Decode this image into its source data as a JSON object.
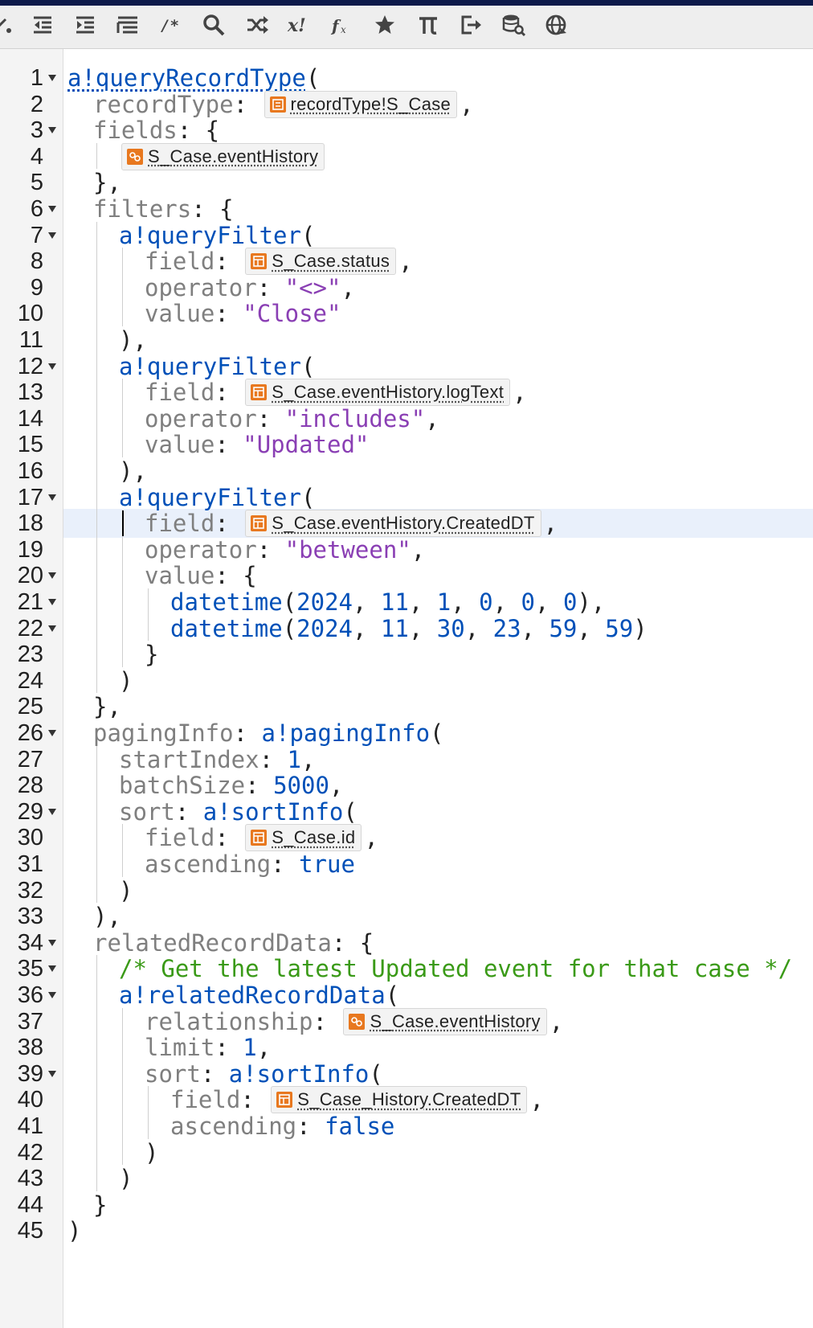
{
  "toolbar": {
    "buttons": [
      {
        "name": "partial-icon",
        "interactable": true
      },
      {
        "name": "outdent-icon",
        "interactable": true
      },
      {
        "name": "indent-icon",
        "interactable": true
      },
      {
        "name": "format-icon",
        "interactable": true
      },
      {
        "name": "comment-icon",
        "interactable": true
      },
      {
        "name": "search-icon",
        "interactable": true
      },
      {
        "name": "shuffle-icon",
        "interactable": true
      },
      {
        "name": "test-variable-icon",
        "interactable": true
      },
      {
        "name": "function-icon",
        "interactable": true
      },
      {
        "name": "favorite-star-icon",
        "interactable": true
      },
      {
        "name": "pi-constant-icon",
        "interactable": true
      },
      {
        "name": "export-icon",
        "interactable": true
      },
      {
        "name": "query-data-icon",
        "interactable": true
      },
      {
        "name": "web-api-icon",
        "interactable": true
      }
    ]
  },
  "editor": {
    "highlighted_line": 18,
    "fold_lines": [
      1,
      3,
      6,
      7,
      12,
      17,
      20,
      21,
      22,
      26,
      29,
      34,
      35,
      36,
      39
    ],
    "lines": [
      {
        "n": "1",
        "indent": 0,
        "tokens": [
          {
            "c": "kwu",
            "t": "a!queryRecordType"
          },
          {
            "c": "pun",
            "t": "("
          }
        ]
      },
      {
        "n": "2",
        "indent": 1,
        "tokens": [
          {
            "c": "key",
            "t": "recordType"
          },
          {
            "c": "pun",
            "t": ": "
          },
          {
            "c": "chip",
            "icon": "record",
            "t": "recordType!S_Case"
          },
          {
            "c": "pun",
            "t": ","
          }
        ]
      },
      {
        "n": "3",
        "indent": 1,
        "tokens": [
          {
            "c": "key",
            "t": "fields"
          },
          {
            "c": "pun",
            "t": ": {"
          }
        ]
      },
      {
        "n": "4",
        "indent": 2,
        "tokens": [
          {
            "c": "chip",
            "icon": "relation",
            "t": "S_Case.eventHistory"
          }
        ]
      },
      {
        "n": "5",
        "indent": 1,
        "tokens": [
          {
            "c": "pun",
            "t": "},"
          }
        ]
      },
      {
        "n": "6",
        "indent": 1,
        "tokens": [
          {
            "c": "key",
            "t": "filters"
          },
          {
            "c": "pun",
            "t": ": {"
          }
        ]
      },
      {
        "n": "7",
        "indent": 2,
        "tokens": [
          {
            "c": "kw",
            "t": "a!queryFilter"
          },
          {
            "c": "pun",
            "t": "("
          }
        ]
      },
      {
        "n": "8",
        "indent": 3,
        "tokens": [
          {
            "c": "key",
            "t": "field"
          },
          {
            "c": "pun",
            "t": ": "
          },
          {
            "c": "chip",
            "icon": "field",
            "t": "S_Case.status"
          },
          {
            "c": "pun",
            "t": ","
          }
        ]
      },
      {
        "n": "9",
        "indent": 3,
        "tokens": [
          {
            "c": "key",
            "t": "operator"
          },
          {
            "c": "pun",
            "t": ": "
          },
          {
            "c": "str",
            "t": "\"<>\""
          },
          {
            "c": "pun",
            "t": ","
          }
        ]
      },
      {
        "n": "10",
        "indent": 3,
        "tokens": [
          {
            "c": "key",
            "t": "value"
          },
          {
            "c": "pun",
            "t": ": "
          },
          {
            "c": "str",
            "t": "\"Close\""
          }
        ]
      },
      {
        "n": "11",
        "indent": 2,
        "tokens": [
          {
            "c": "pun",
            "t": "),"
          }
        ]
      },
      {
        "n": "12",
        "indent": 2,
        "tokens": [
          {
            "c": "kw",
            "t": "a!queryFilter"
          },
          {
            "c": "pun",
            "t": "("
          }
        ]
      },
      {
        "n": "13",
        "indent": 3,
        "tokens": [
          {
            "c": "key",
            "t": "field"
          },
          {
            "c": "pun",
            "t": ": "
          },
          {
            "c": "chip",
            "icon": "field",
            "t": "S_Case.eventHistory.logText"
          },
          {
            "c": "pun",
            "t": ","
          }
        ]
      },
      {
        "n": "14",
        "indent": 3,
        "tokens": [
          {
            "c": "key",
            "t": "operator"
          },
          {
            "c": "pun",
            "t": ": "
          },
          {
            "c": "str",
            "t": "\"includes\""
          },
          {
            "c": "pun",
            "t": ","
          }
        ]
      },
      {
        "n": "15",
        "indent": 3,
        "tokens": [
          {
            "c": "key",
            "t": "value"
          },
          {
            "c": "pun",
            "t": ": "
          },
          {
            "c": "str",
            "t": "\"Updated\""
          }
        ]
      },
      {
        "n": "16",
        "indent": 2,
        "tokens": [
          {
            "c": "pun",
            "t": "),"
          }
        ]
      },
      {
        "n": "17",
        "indent": 2,
        "tokens": [
          {
            "c": "kw",
            "t": "a!queryFilter"
          },
          {
            "c": "pun",
            "t": "("
          }
        ]
      },
      {
        "n": "18",
        "indent": 3,
        "tokens": [
          {
            "c": "key",
            "t": "field"
          },
          {
            "c": "pun",
            "t": ": "
          },
          {
            "c": "chip",
            "icon": "field",
            "t": "S_Case.eventHistory.CreatedDT"
          },
          {
            "c": "pun",
            "t": ","
          }
        ]
      },
      {
        "n": "19",
        "indent": 3,
        "tokens": [
          {
            "c": "key",
            "t": "operator"
          },
          {
            "c": "pun",
            "t": ": "
          },
          {
            "c": "str",
            "t": "\"between\""
          },
          {
            "c": "pun",
            "t": ","
          }
        ]
      },
      {
        "n": "20",
        "indent": 3,
        "tokens": [
          {
            "c": "key",
            "t": "value"
          },
          {
            "c": "pun",
            "t": ": {"
          }
        ]
      },
      {
        "n": "21",
        "indent": 4,
        "tokens": [
          {
            "c": "kw",
            "t": "datetime"
          },
          {
            "c": "pun",
            "t": "("
          },
          {
            "c": "num",
            "t": "2024"
          },
          {
            "c": "pun",
            "t": ", "
          },
          {
            "c": "num",
            "t": "11"
          },
          {
            "c": "pun",
            "t": ", "
          },
          {
            "c": "num",
            "t": "1"
          },
          {
            "c": "pun",
            "t": ", "
          },
          {
            "c": "num",
            "t": "0"
          },
          {
            "c": "pun",
            "t": ", "
          },
          {
            "c": "num",
            "t": "0"
          },
          {
            "c": "pun",
            "t": ", "
          },
          {
            "c": "num",
            "t": "0"
          },
          {
            "c": "pun",
            "t": "),"
          }
        ]
      },
      {
        "n": "22",
        "indent": 4,
        "tokens": [
          {
            "c": "kw",
            "t": "datetime"
          },
          {
            "c": "pun",
            "t": "("
          },
          {
            "c": "num",
            "t": "2024"
          },
          {
            "c": "pun",
            "t": ", "
          },
          {
            "c": "num",
            "t": "11"
          },
          {
            "c": "pun",
            "t": ", "
          },
          {
            "c": "num",
            "t": "30"
          },
          {
            "c": "pun",
            "t": ", "
          },
          {
            "c": "num",
            "t": "23"
          },
          {
            "c": "pun",
            "t": ", "
          },
          {
            "c": "num",
            "t": "59"
          },
          {
            "c": "pun",
            "t": ", "
          },
          {
            "c": "num",
            "t": "59"
          },
          {
            "c": "pun",
            "t": ")"
          }
        ]
      },
      {
        "n": "23",
        "indent": 3,
        "tokens": [
          {
            "c": "pun",
            "t": "}"
          }
        ]
      },
      {
        "n": "24",
        "indent": 2,
        "tokens": [
          {
            "c": "pun",
            "t": ")"
          }
        ]
      },
      {
        "n": "25",
        "indent": 1,
        "tokens": [
          {
            "c": "pun",
            "t": "},"
          }
        ]
      },
      {
        "n": "26",
        "indent": 1,
        "tokens": [
          {
            "c": "key",
            "t": "pagingInfo"
          },
          {
            "c": "pun",
            "t": ": "
          },
          {
            "c": "kw",
            "t": "a!pagingInfo"
          },
          {
            "c": "pun",
            "t": "("
          }
        ]
      },
      {
        "n": "27",
        "indent": 2,
        "tokens": [
          {
            "c": "key",
            "t": "startIndex"
          },
          {
            "c": "pun",
            "t": ": "
          },
          {
            "c": "num",
            "t": "1"
          },
          {
            "c": "pun",
            "t": ","
          }
        ]
      },
      {
        "n": "28",
        "indent": 2,
        "tokens": [
          {
            "c": "key",
            "t": "batchSize"
          },
          {
            "c": "pun",
            "t": ": "
          },
          {
            "c": "num",
            "t": "5000"
          },
          {
            "c": "pun",
            "t": ","
          }
        ]
      },
      {
        "n": "29",
        "indent": 2,
        "tokens": [
          {
            "c": "key",
            "t": "sort"
          },
          {
            "c": "pun",
            "t": ": "
          },
          {
            "c": "kw",
            "t": "a!sortInfo"
          },
          {
            "c": "pun",
            "t": "("
          }
        ]
      },
      {
        "n": "30",
        "indent": 3,
        "tokens": [
          {
            "c": "key",
            "t": "field"
          },
          {
            "c": "pun",
            "t": ": "
          },
          {
            "c": "chip",
            "icon": "field",
            "t": "S_Case.id"
          },
          {
            "c": "pun",
            "t": ","
          }
        ]
      },
      {
        "n": "31",
        "indent": 3,
        "tokens": [
          {
            "c": "key",
            "t": "ascending"
          },
          {
            "c": "pun",
            "t": ": "
          },
          {
            "c": "bool",
            "t": "true"
          }
        ]
      },
      {
        "n": "32",
        "indent": 2,
        "tokens": [
          {
            "c": "pun",
            "t": ")"
          }
        ]
      },
      {
        "n": "33",
        "indent": 1,
        "tokens": [
          {
            "c": "pun",
            "t": "),"
          }
        ]
      },
      {
        "n": "34",
        "indent": 1,
        "tokens": [
          {
            "c": "key",
            "t": "relatedRecordData"
          },
          {
            "c": "pun",
            "t": ": {"
          }
        ]
      },
      {
        "n": "35",
        "indent": 2,
        "tokens": [
          {
            "c": "com",
            "t": "/* Get the latest Updated event for that case */"
          }
        ]
      },
      {
        "n": "36",
        "indent": 2,
        "tokens": [
          {
            "c": "kw",
            "t": "a!relatedRecordData"
          },
          {
            "c": "pun",
            "t": "("
          }
        ]
      },
      {
        "n": "37",
        "indent": 3,
        "tokens": [
          {
            "c": "key",
            "t": "relationship"
          },
          {
            "c": "pun",
            "t": ": "
          },
          {
            "c": "chip",
            "icon": "relation",
            "t": "S_Case.eventHistory"
          },
          {
            "c": "pun",
            "t": ","
          }
        ]
      },
      {
        "n": "38",
        "indent": 3,
        "tokens": [
          {
            "c": "key",
            "t": "limit"
          },
          {
            "c": "pun",
            "t": ": "
          },
          {
            "c": "num",
            "t": "1"
          },
          {
            "c": "pun",
            "t": ","
          }
        ]
      },
      {
        "n": "39",
        "indent": 3,
        "tokens": [
          {
            "c": "key",
            "t": "sort"
          },
          {
            "c": "pun",
            "t": ": "
          },
          {
            "c": "kw",
            "t": "a!sortInfo"
          },
          {
            "c": "pun",
            "t": "("
          }
        ]
      },
      {
        "n": "40",
        "indent": 4,
        "tokens": [
          {
            "c": "key",
            "t": "field"
          },
          {
            "c": "pun",
            "t": ": "
          },
          {
            "c": "chip",
            "icon": "field",
            "t": "S_Case_History.CreatedDT"
          },
          {
            "c": "pun",
            "t": ","
          }
        ]
      },
      {
        "n": "41",
        "indent": 4,
        "tokens": [
          {
            "c": "key",
            "t": "ascending"
          },
          {
            "c": "pun",
            "t": ": "
          },
          {
            "c": "bool",
            "t": "false"
          }
        ]
      },
      {
        "n": "42",
        "indent": 3,
        "tokens": [
          {
            "c": "pun",
            "t": ")"
          }
        ]
      },
      {
        "n": "43",
        "indent": 2,
        "tokens": [
          {
            "c": "pun",
            "t": ")"
          }
        ]
      },
      {
        "n": "44",
        "indent": 1,
        "tokens": [
          {
            "c": "pun",
            "t": "}"
          }
        ]
      },
      {
        "n": "45",
        "indent": 0,
        "tokens": [
          {
            "c": "pun",
            "t": ")"
          }
        ]
      }
    ]
  }
}
